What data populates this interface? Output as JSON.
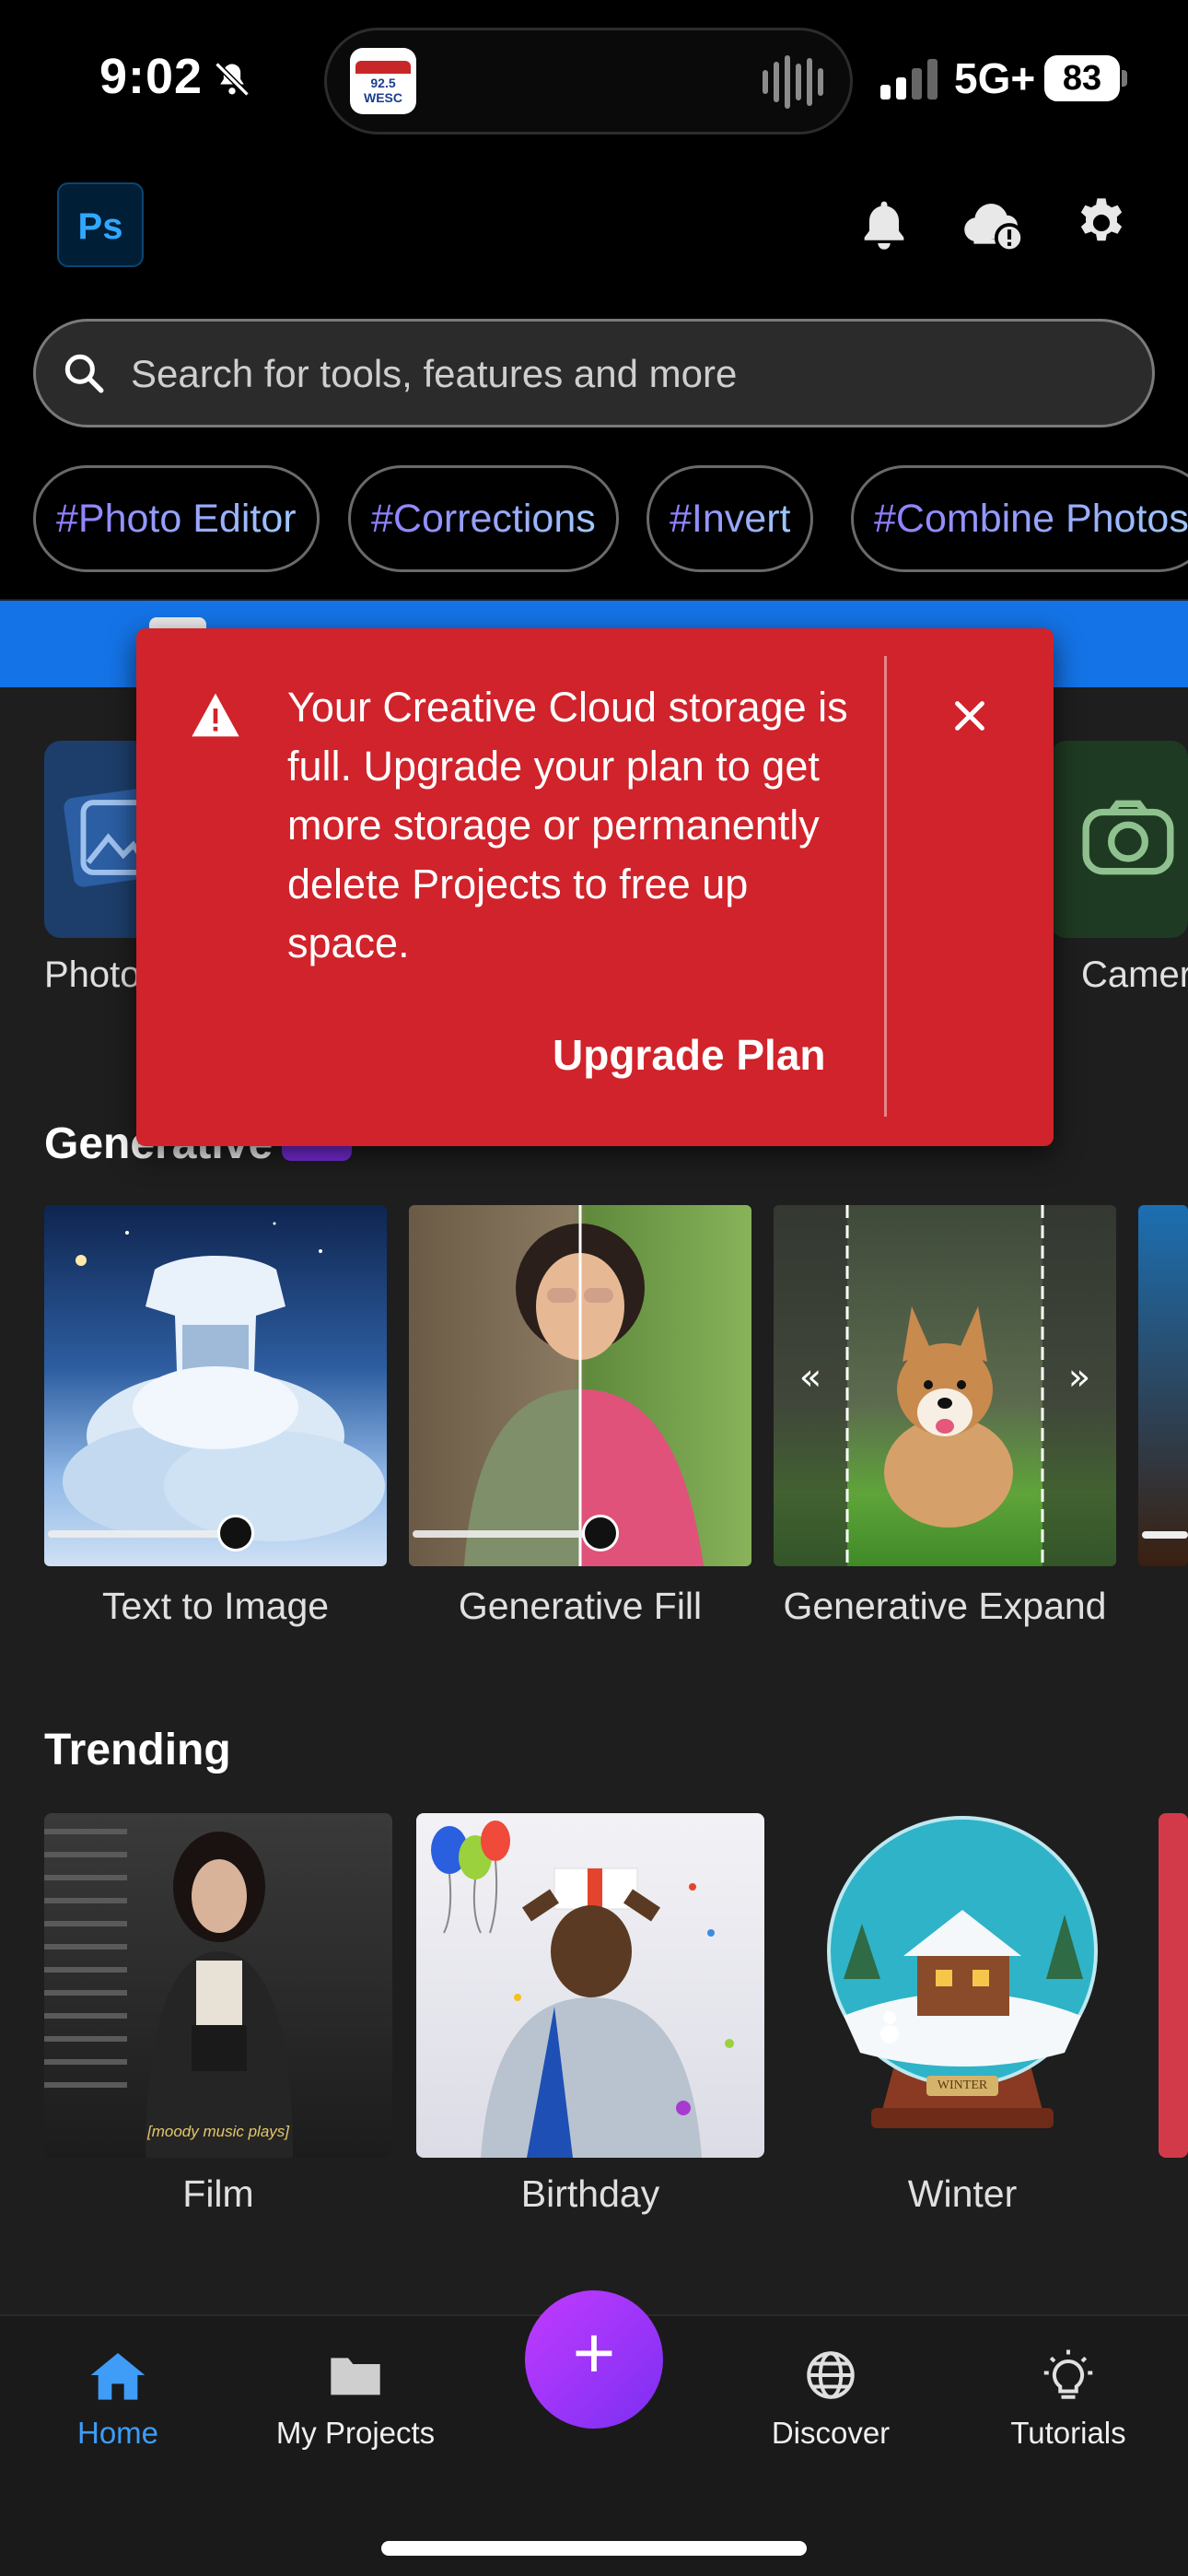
{
  "status": {
    "time": "9:02",
    "island_app_text": "92.5 WESC",
    "network": "5G+",
    "battery": "83"
  },
  "header": {
    "logo_text": "Ps"
  },
  "search": {
    "placeholder": "Search for tools, features and more"
  },
  "chips": [
    "#Photo Editor",
    "#Corrections",
    "#Invert",
    "#Combine Photos"
  ],
  "quick_actions": {
    "left_label": "Photo",
    "right_label": "Camera"
  },
  "alert": {
    "message": "Your Creative Cloud storage is full. Upgrade your plan to get more storage or permanently delete Projects to free up space.",
    "action": "Upgrade Plan"
  },
  "generative": {
    "title": "Generative",
    "items": [
      {
        "label": "Text to Image"
      },
      {
        "label": "Generative Fill"
      },
      {
        "label": "Generative Expand"
      }
    ]
  },
  "trending": {
    "title": "Trending",
    "items": [
      {
        "label": "Film",
        "caption": "[moody music plays]"
      },
      {
        "label": "Birthday"
      },
      {
        "label": "Winter",
        "caption": "WINTER"
      }
    ]
  },
  "nav": {
    "items": [
      {
        "label": "Home",
        "icon": "home-icon",
        "active": true
      },
      {
        "label": "My Projects",
        "icon": "folder-icon"
      },
      {
        "label": "Discover",
        "icon": "globe-icon"
      },
      {
        "label": "Tutorials",
        "icon": "lightbulb-icon"
      }
    ],
    "fab": "+"
  },
  "colors": {
    "accent": "#1473e6",
    "alert": "#d0232b",
    "fab": "#9b35f7",
    "active_nav": "#3f9cf7"
  }
}
